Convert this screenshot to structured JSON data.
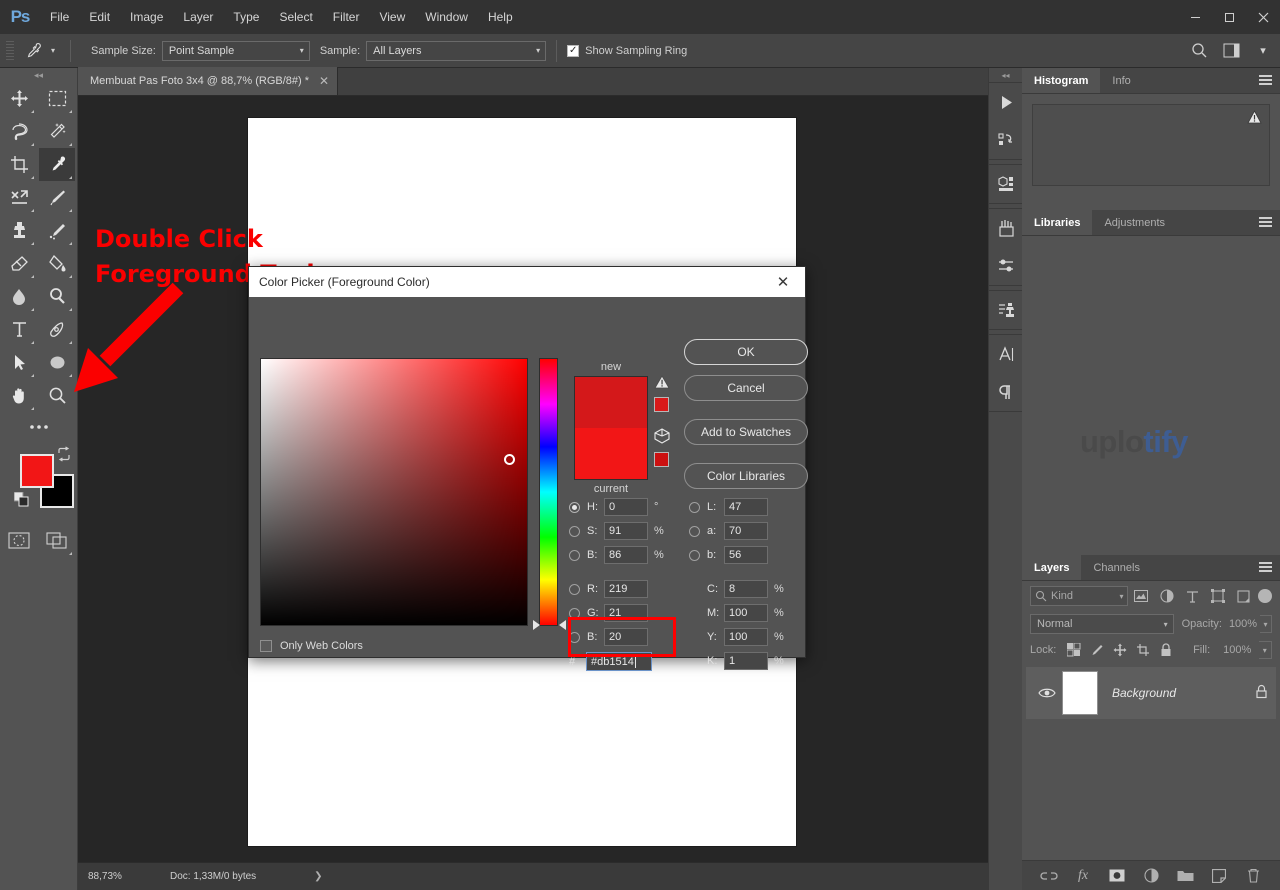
{
  "app": {
    "logo": "Ps",
    "menus": [
      "File",
      "Edit",
      "Image",
      "Layer",
      "Type",
      "Select",
      "Filter",
      "View",
      "Window",
      "Help"
    ],
    "window_controls": {
      "minimize": "–",
      "maximize": "▢",
      "close": "✕"
    }
  },
  "options_bar": {
    "tool_icon": "eyedropper-icon",
    "sample_size_label": "Sample Size:",
    "sample_size_value": "Point Sample",
    "sample_label": "Sample:",
    "sample_value": "All Layers",
    "show_sampling_ring_label": "Show Sampling Ring",
    "show_sampling_ring_checked": true
  },
  "toolbar": {
    "tools": [
      {
        "name": "move-tool",
        "glyph": "move",
        "selected": false,
        "has_flyout": true
      },
      {
        "name": "rectangular-marquee-tool",
        "glyph": "marquee",
        "selected": false,
        "has_flyout": true
      },
      {
        "name": "lasso-tool",
        "glyph": "lasso",
        "selected": false,
        "has_flyout": true
      },
      {
        "name": "magic-wand-tool",
        "glyph": "wand",
        "selected": false,
        "has_flyout": true
      },
      {
        "name": "crop-tool",
        "glyph": "crop",
        "selected": false,
        "has_flyout": true
      },
      {
        "name": "eyedropper-tool",
        "glyph": "eyedropper",
        "selected": true,
        "has_flyout": true
      },
      {
        "name": "healing-brush-tool",
        "glyph": "healing",
        "selected": false,
        "has_flyout": true
      },
      {
        "name": "brush-tool",
        "glyph": "brush",
        "selected": false,
        "has_flyout": true
      },
      {
        "name": "clone-stamp-tool",
        "glyph": "stamp",
        "selected": false,
        "has_flyout": true
      },
      {
        "name": "history-brush-tool",
        "glyph": "historybrush",
        "selected": false,
        "has_flyout": true
      },
      {
        "name": "eraser-tool",
        "glyph": "eraser",
        "selected": false,
        "has_flyout": true
      },
      {
        "name": "gradient-tool",
        "glyph": "bucket",
        "selected": false,
        "has_flyout": true
      },
      {
        "name": "blur-tool",
        "glyph": "blur",
        "selected": false,
        "has_flyout": true
      },
      {
        "name": "dodge-tool",
        "glyph": "dodge",
        "selected": false,
        "has_flyout": true
      },
      {
        "name": "type-tool",
        "glyph": "type",
        "selected": false,
        "has_flyout": true
      },
      {
        "name": "pen-tool",
        "glyph": "pen",
        "selected": false,
        "has_flyout": true
      },
      {
        "name": "path-selection-tool",
        "glyph": "arrow",
        "selected": false,
        "has_flyout": true
      },
      {
        "name": "ellipse-shape-tool",
        "glyph": "ellipse",
        "selected": false,
        "has_flyout": true
      },
      {
        "name": "hand-tool",
        "glyph": "hand",
        "selected": false,
        "has_flyout": true
      },
      {
        "name": "zoom-tool",
        "glyph": "zoom",
        "selected": false,
        "has_flyout": false
      }
    ],
    "edit_toolbar_glyph": "ellipsis",
    "foreground_color": "#f21616",
    "background_color": "#000000",
    "quick_mask_glyph": "quickmask",
    "screen_mode_glyph": "screenmode"
  },
  "document": {
    "tab_title": "Membuat Pas Foto 3x4 @ 88,7% (RGB/8#) *",
    "close_glyph": "✕"
  },
  "status_bar": {
    "zoom": "88,73%",
    "doc_info": "Doc: 1,33M/0 bytes",
    "expander": "❯"
  },
  "icon_rail": {
    "groups": [
      [
        "play-actions-icon",
        "history-icon"
      ],
      [
        "3d-icon"
      ],
      [
        "brushes-icon",
        "brush-settings-icon"
      ],
      [
        "clone-source-icon"
      ],
      [
        "character-panel-icon",
        "paragraph-panel-icon"
      ]
    ]
  },
  "right_panels": {
    "histogram": {
      "tabs": [
        {
          "label": "Histogram",
          "active": true
        },
        {
          "label": "Info",
          "active": false
        }
      ],
      "warning_glyph": "warning-triangle"
    },
    "libraries": {
      "tabs": [
        {
          "label": "Libraries",
          "active": true
        },
        {
          "label": "Adjustments",
          "active": false
        }
      ]
    },
    "watermark": {
      "part_a": "uplo",
      "part_b": "tify"
    },
    "layers": {
      "tabs": [
        {
          "label": "Layers",
          "active": true
        },
        {
          "label": "Channels",
          "active": false
        }
      ],
      "filter_value": "Kind",
      "filter_icons": [
        "pixel-filter-icon",
        "adjustment-filter-icon",
        "type-filter-icon",
        "shape-filter-icon",
        "smart-object-filter-icon"
      ],
      "blend_mode": "Normal",
      "opacity_label": "Opacity:",
      "opacity_value": "100%",
      "lock_label": "Lock:",
      "lock_icons": [
        "lock-transparent-icon",
        "lock-image-icon",
        "lock-position-icon",
        "lock-artboard-icon",
        "lock-all-icon"
      ],
      "fill_label": "Fill:",
      "fill_value": "100%",
      "rows": [
        {
          "name": "Background",
          "visible": true,
          "locked": true,
          "thumb_color": "#ffffff"
        }
      ],
      "footer_icons": [
        "link-layers-icon",
        "layer-style-fx-icon",
        "add-mask-icon",
        "adjustment-layer-icon",
        "new-group-icon",
        "new-layer-icon",
        "delete-layer-icon"
      ]
    }
  },
  "annotation": {
    "line1": "Double Click",
    "line2": "Foreground Tool",
    "color": "#fb0000",
    "arrow": "red-arrow-pointing-down-left"
  },
  "color_picker": {
    "title": "Color Picker (Foreground Color)",
    "close_glyph": "✕",
    "new_label": "new",
    "current_label": "current",
    "new_color": "#d4181a",
    "current_color": "#f21616",
    "out_of_gamut_warning_glyph": "warning-triangle",
    "out_of_gamut_swatch": "#d81a1a",
    "web_safe_glyph": "cube",
    "web_safe_swatch": "#cc1111",
    "buttons": [
      {
        "label": "OK",
        "primary": true
      },
      {
        "label": "Cancel",
        "primary": false
      },
      {
        "label": "Add to Swatches",
        "primary": false
      },
      {
        "label": "Color Libraries",
        "primary": false
      }
    ],
    "only_web_colors_label": "Only Web Colors",
    "only_web_colors_checked": false,
    "hsb": [
      {
        "key": "H:",
        "value": "0",
        "unit": "°",
        "selected": true
      },
      {
        "key": "S:",
        "value": "91",
        "unit": "%",
        "selected": false
      },
      {
        "key": "B:",
        "value": "86",
        "unit": "%",
        "selected": false
      }
    ],
    "rgb": [
      {
        "key": "R:",
        "value": "219",
        "unit": "",
        "selected": false
      },
      {
        "key": "G:",
        "value": "21",
        "unit": "",
        "selected": false
      },
      {
        "key": "B:",
        "value": "20",
        "unit": "",
        "selected": false
      }
    ],
    "lab": [
      {
        "key": "L:",
        "value": "47",
        "unit": "",
        "selected": false
      },
      {
        "key": "a:",
        "value": "70",
        "unit": "",
        "selected": false
      },
      {
        "key": "b:",
        "value": "56",
        "unit": "",
        "selected": false
      }
    ],
    "cmyk": [
      {
        "key": "C:",
        "value": "8",
        "unit": "%"
      },
      {
        "key": "M:",
        "value": "100",
        "unit": "%"
      },
      {
        "key": "Y:",
        "value": "100",
        "unit": "%"
      },
      {
        "key": "K:",
        "value": "1",
        "unit": "%"
      }
    ],
    "hex_symbol": "#",
    "hex_value": "#db1514",
    "hex_highlight_color": "#ff0000"
  }
}
